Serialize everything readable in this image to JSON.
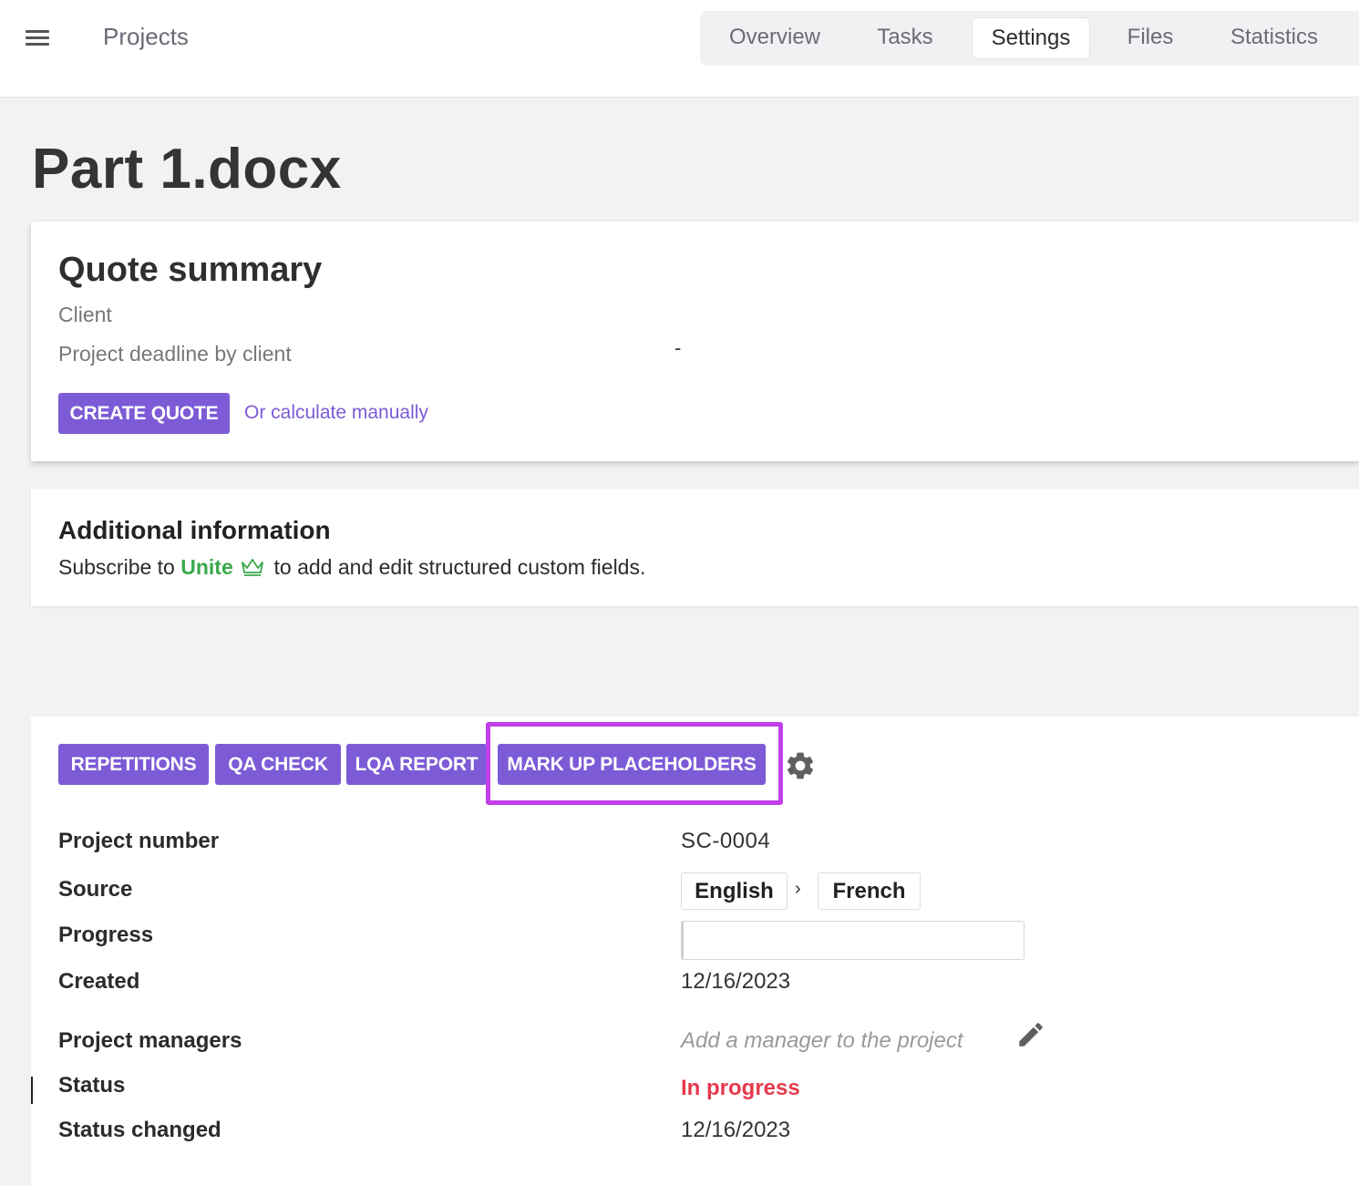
{
  "header": {
    "menu_icon": "hamburger-menu-icon",
    "projects_label": "Projects",
    "tabs": [
      {
        "label": "Overview",
        "active": false
      },
      {
        "label": "Tasks",
        "active": false
      },
      {
        "label": "Settings",
        "active": true
      },
      {
        "label": "Files",
        "active": false
      },
      {
        "label": "Statistics",
        "active": false
      }
    ]
  },
  "page": {
    "title": "Part 1.docx"
  },
  "quote_summary": {
    "title": "Quote summary",
    "client_label": "Client",
    "deadline_label": "Project deadline by client",
    "deadline_value": "-",
    "create_quote_label": "CREATE QUOTE",
    "calculate_manually_label": "Or calculate manually"
  },
  "additional_info": {
    "title": "Additional information",
    "text_before": "Subscribe to",
    "unite_label": "Unite",
    "crown_icon": "crown-icon",
    "text_after": "to add and edit structured custom fields."
  },
  "details": {
    "buttons": {
      "repetitions": "REPETITIONS",
      "qa_check": "QA CHECK",
      "lqa_report": "LQA REPORT",
      "mark_up_placeholders": "MARK UP PLACEHOLDERS"
    },
    "settings_icon": "gear-icon",
    "project_number_label": "Project number",
    "project_number_value": "SC-0004",
    "source_label": "Source",
    "source_language": "English",
    "language_arrow": "›",
    "target_language": "French",
    "progress_label": "Progress",
    "created_label": "Created",
    "created_value": "12/16/2023",
    "managers_label": "Project managers",
    "managers_placeholder": "Add a manager to the project",
    "edit_icon": "pencil-icon",
    "status_label": "Status",
    "status_value": "In progress",
    "status_changed_label": "Status changed",
    "status_changed_value": "12/16/2023"
  },
  "colors": {
    "accent": "#7d5bd6",
    "highlight": "#c23fea",
    "unite": "#3aa84b",
    "status_in_progress": "#e53a4c"
  }
}
